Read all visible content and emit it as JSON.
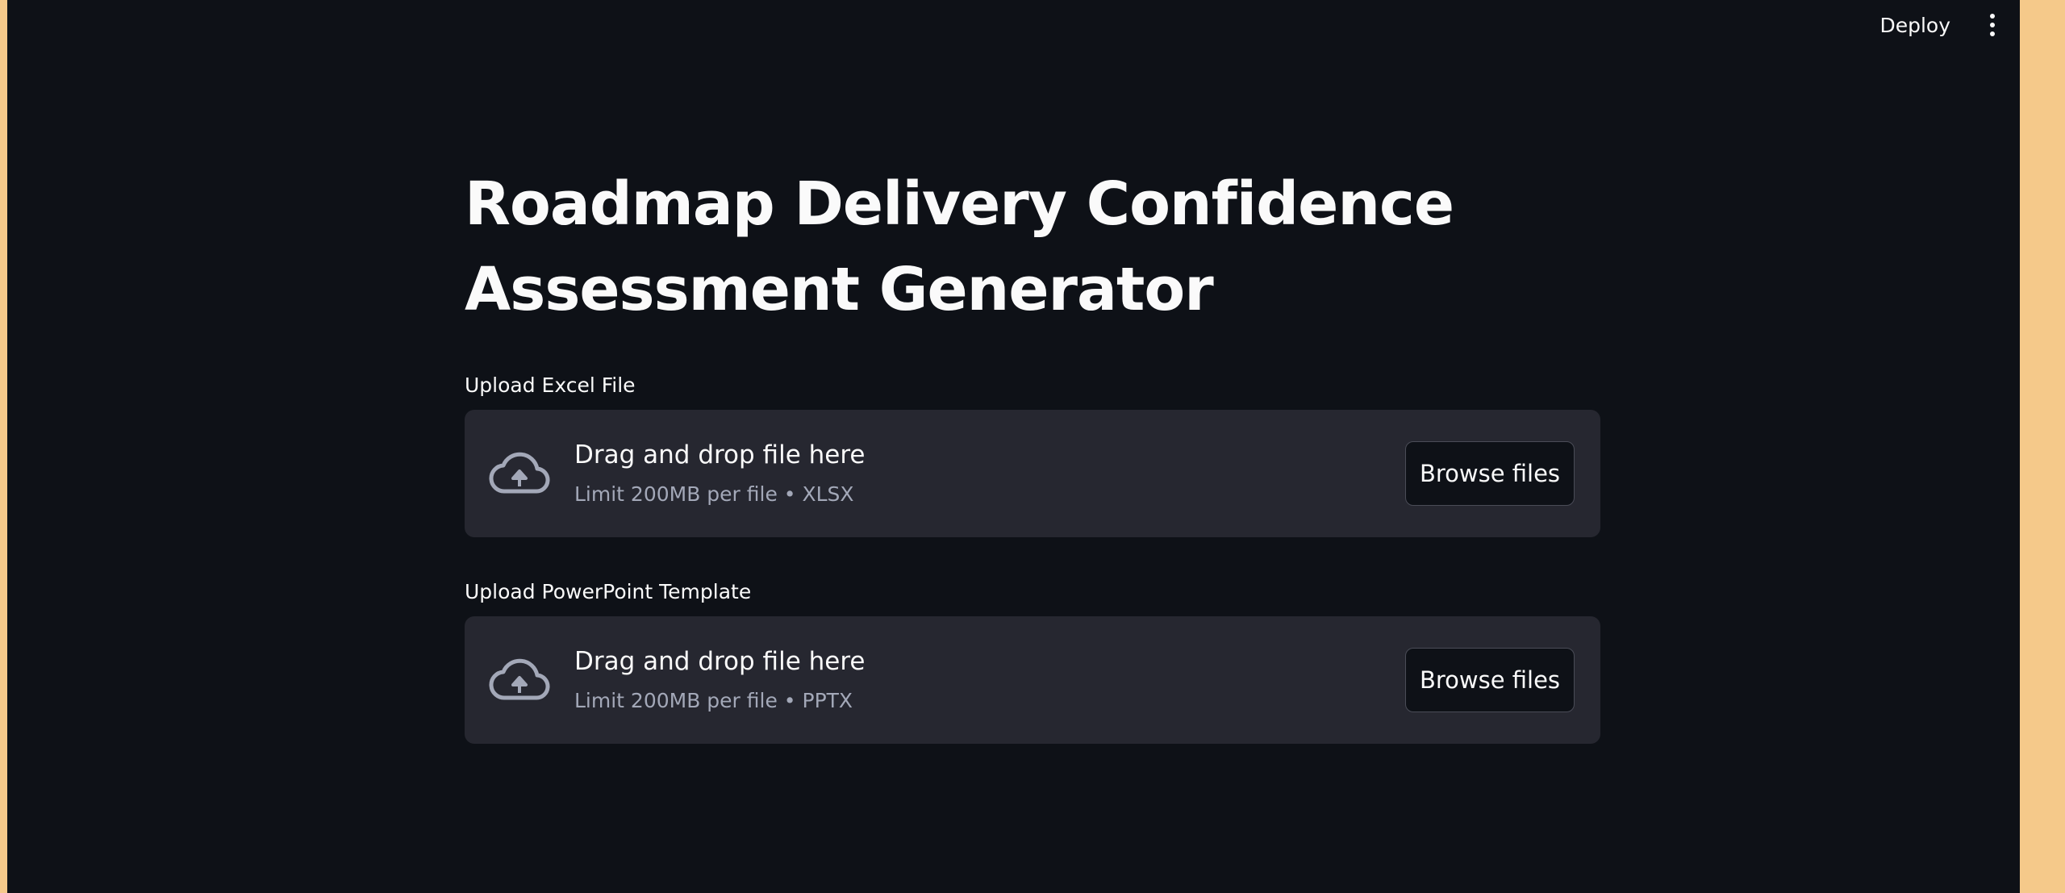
{
  "toolbar": {
    "deploy_label": "Deploy",
    "menu_icon": "vertical-ellipsis-icon"
  },
  "main": {
    "title_line1": "Roadmap Delivery Confidence",
    "title_line2": "Assessment Generator",
    "uploaders": [
      {
        "label": "Upload Excel File",
        "drop_text": "Drag and drop file here",
        "limit_text": "Limit 200MB per file • XLSX",
        "button_label": "Browse files",
        "icon": "cloud-upload-icon"
      },
      {
        "label": "Upload PowerPoint Template",
        "drop_text": "Drag and drop file here",
        "limit_text": "Limit 200MB per file • PPTX",
        "button_label": "Browse files",
        "icon": "cloud-upload-icon"
      }
    ]
  },
  "colors": {
    "background": "#0e1117",
    "dropzone": "#262730",
    "text": "#fafafa",
    "muted_text": "#a3a8b8",
    "edge_accent": "#f5c98a"
  }
}
